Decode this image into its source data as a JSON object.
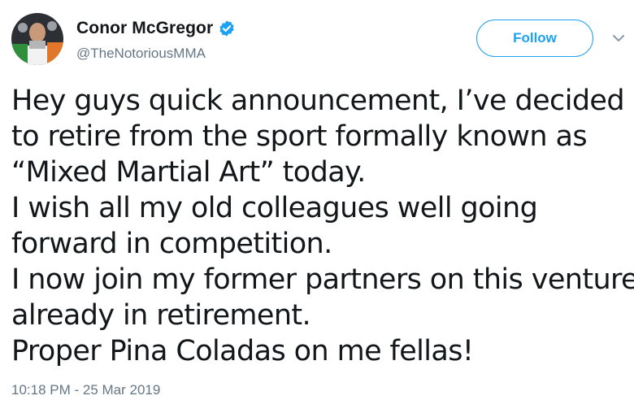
{
  "user": {
    "display_name": "Conor McGregor",
    "handle": "@TheNotoriousMMA",
    "verified": true
  },
  "actions": {
    "follow_label": "Follow",
    "more_icon": "chevron-down-icon"
  },
  "tweet": {
    "lines": [
      "Hey guys quick announcement, I’ve decided",
      "to retire from the sport formally known as",
      "“Mixed Martial Art” today.",
      "I wish all my old colleagues well going",
      "forward in competition.",
      "I now join my former partners on this venture,",
      "already in retirement.",
      "Proper Pina Coladas on me fellas!"
    ],
    "timestamp": "10:18 PM - 25 Mar 2019"
  },
  "colors": {
    "accent": "#1da1f2",
    "text": "#14171a",
    "muted": "#657786"
  }
}
